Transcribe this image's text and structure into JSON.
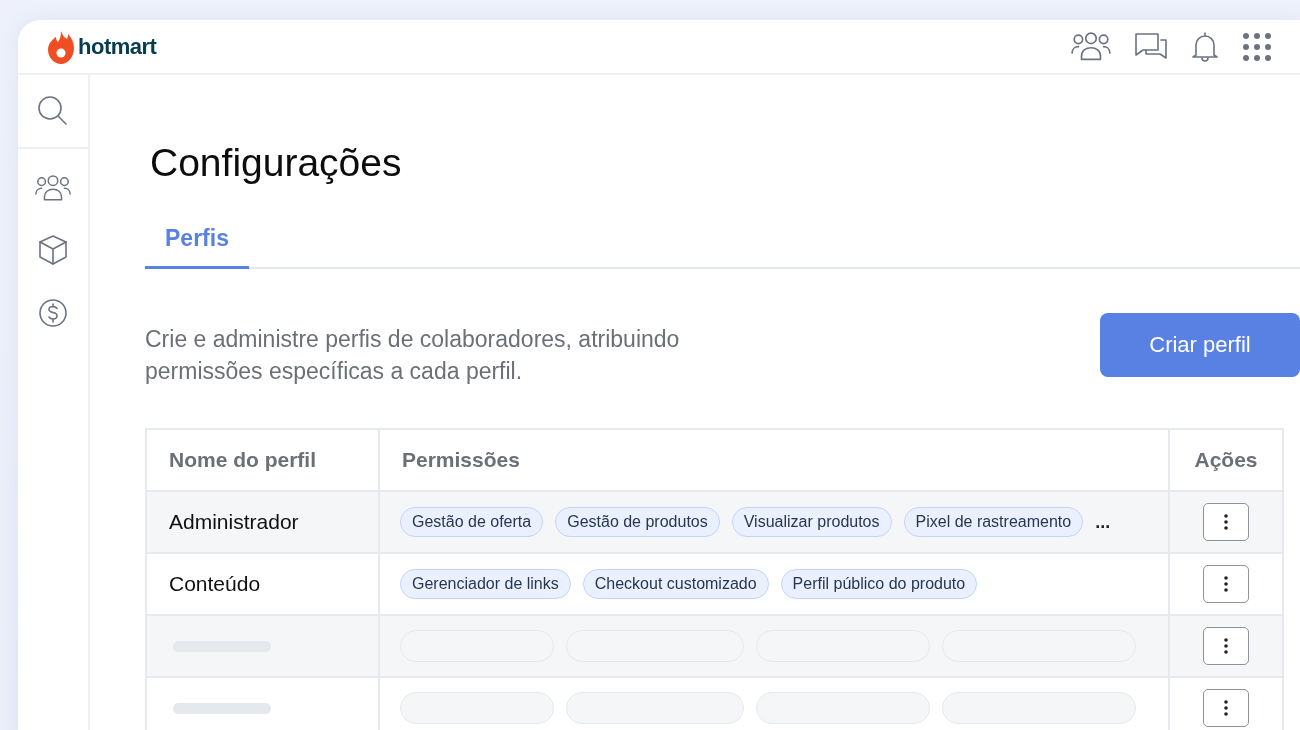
{
  "header": {
    "logo_text": "hotmart"
  },
  "page": {
    "title": "Configurações",
    "tabs": [
      {
        "label": "Perfis",
        "selected": true
      }
    ],
    "description": "Crie e administre perfis de colaboradores, atribuindo permissões específicas a cada perfil.",
    "primary_button": "Criar perfil"
  },
  "table": {
    "columns": [
      "Nome do perfil",
      "Permissões",
      "Ações"
    ],
    "rows": [
      {
        "kind": "profile",
        "name": "Administrador",
        "permissions": [
          "Gestão de oferta",
          "Gestão de produtos",
          "Visualizar produtos",
          "Pixel de rastreamento"
        ],
        "overflow": "..."
      },
      {
        "kind": "profile",
        "name": "Conteúdo",
        "permissions": [
          "Gerenciador de links",
          "Checkout customizado",
          "Perfil público do produto"
        ]
      },
      {
        "kind": "skeleton"
      },
      {
        "kind": "skeleton"
      }
    ]
  }
}
